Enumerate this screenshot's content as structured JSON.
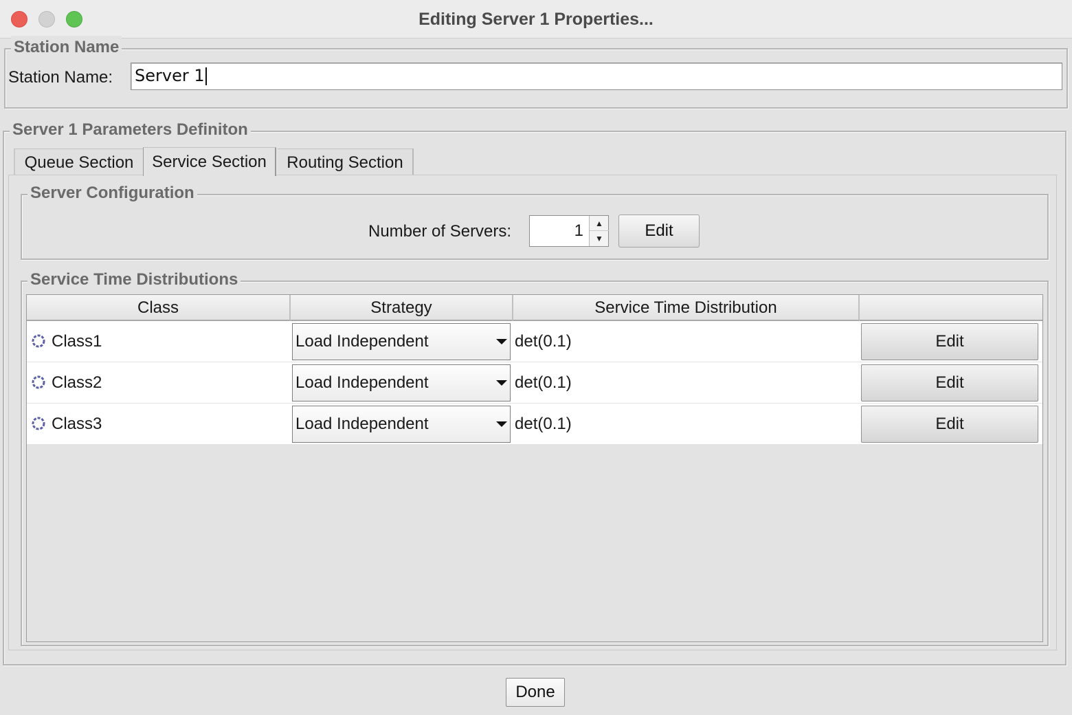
{
  "window": {
    "title": "Editing Server 1 Properties..."
  },
  "station_group": {
    "title": "Station Name",
    "label": "Station Name:",
    "value": "Server 1"
  },
  "params_group": {
    "title": "Server 1 Parameters Definiton"
  },
  "tabs": [
    {
      "label": "Queue Section"
    },
    {
      "label": "Service Section",
      "selected": true
    },
    {
      "label": "Routing Section"
    }
  ],
  "server_config": {
    "title": "Server Configuration",
    "label": "Number of Servers:",
    "value": "1",
    "edit_label": "Edit"
  },
  "service_time": {
    "title": "Service Time Distributions",
    "columns": [
      "Class",
      "Strategy",
      "Service Time Distribution",
      ""
    ],
    "rows": [
      {
        "class": "Class1",
        "strategy": "Load Independent",
        "distribution": "det(0.1)",
        "edit": "Edit"
      },
      {
        "class": "Class2",
        "strategy": "Load Independent",
        "distribution": "det(0.1)",
        "edit": "Edit"
      },
      {
        "class": "Class3",
        "strategy": "Load Independent",
        "distribution": "det(0.1)",
        "edit": "Edit"
      }
    ]
  },
  "footer": {
    "done_label": "Done"
  },
  "icons": {
    "class_icon": "class-ring-icon",
    "spinner_up": "spinner-up-icon",
    "spinner_down": "spinner-down-icon",
    "combo_arrow": "dropdown-arrow-icon"
  },
  "colors": {
    "close": "#ec5f57",
    "minimize": "#d2d2d2",
    "maximize": "#5fc454",
    "group_title": "#6a6a6a"
  }
}
